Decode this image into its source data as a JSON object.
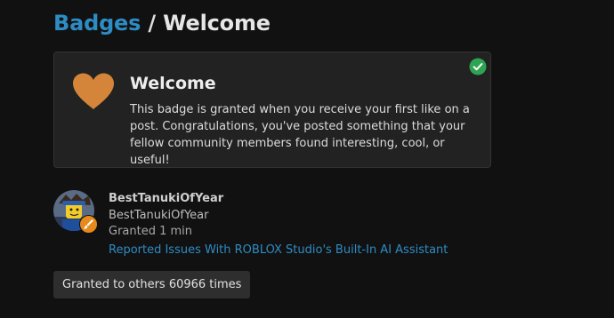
{
  "header": {
    "breadcrumb_parent": "Badges",
    "separator": "/",
    "current": "Welcome"
  },
  "badge": {
    "name": "Welcome",
    "description": "This badge is granted when you receive your first like on a post. Congratulations, you've posted something that your fellow community members found interesting, cool, or useful!",
    "icon": "heart-icon",
    "icon_color": "#d5853a",
    "granted_indicator": "check-icon",
    "granted_color": "#2ea352"
  },
  "grant": {
    "username": "BestTanukiOfYear",
    "user_title": "BestTanukiOfYear",
    "granted_time": "Granted 1 min",
    "topic_title": "Reported Issues With ROBLOX Studio's Built-In AI Assistant",
    "flair_icon": "paintbrush-icon",
    "flair_color": "#e8891c"
  },
  "granted_count": {
    "label": "Granted to others 60966 times"
  },
  "colors": {
    "background": "#111111",
    "card": "#222222",
    "link": "#2e8cc4"
  }
}
